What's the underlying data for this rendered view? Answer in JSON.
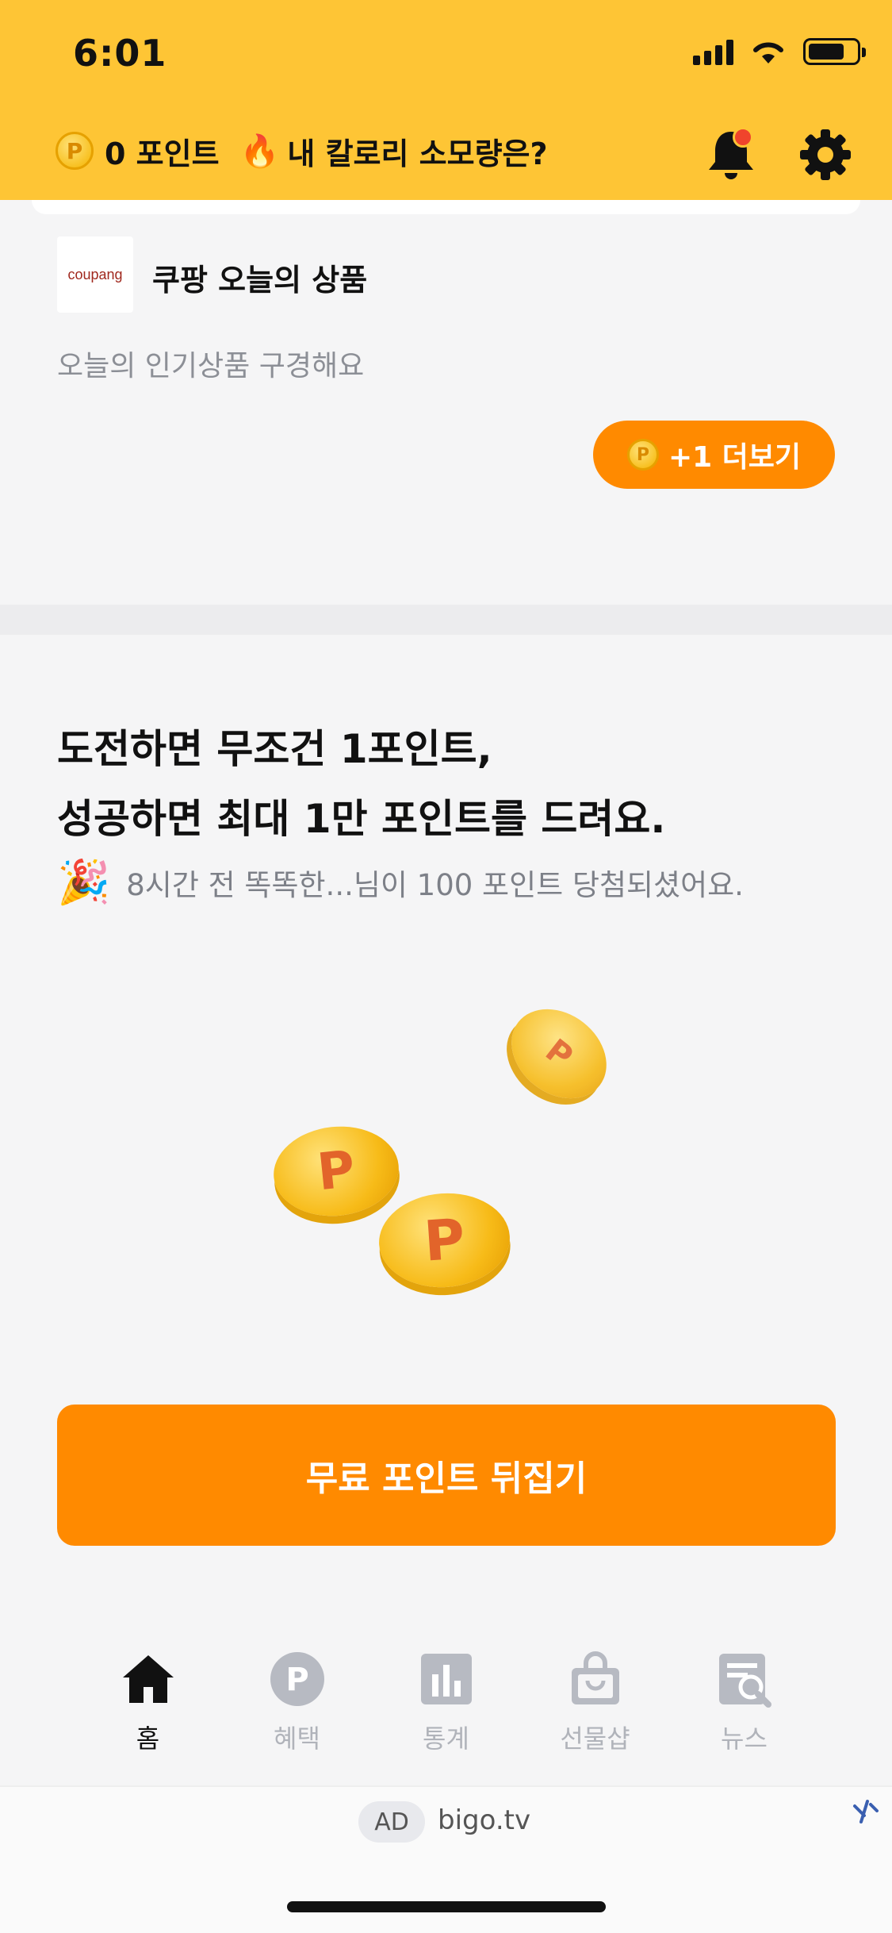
{
  "status_bar": {
    "time": "6:01"
  },
  "header": {
    "points_label": "0 포인트",
    "coin_symbol": "P",
    "calorie_label": "내 칼로리 소모량은?"
  },
  "coupang_card": {
    "logo_text": "coupang",
    "title": "쿠팡 오늘의 상품",
    "description": "오늘의 인기상품 구경해요",
    "more_button": "+1 더보기"
  },
  "challenge": {
    "title_line1": "도전하면 무조건 1포인트,",
    "title_line2": "성공하면 최대 1만 포인트를 드려요.",
    "winner_text": "8시간 전 똑똑한...님이 100 포인트 당첨되셨어요.",
    "coin_symbol": "P",
    "flip_button": "무료 포인트 뒤집기"
  },
  "tabs": [
    {
      "label": "홈",
      "icon": "home-icon",
      "active": true
    },
    {
      "label": "혜택",
      "icon": "point-icon",
      "active": false
    },
    {
      "label": "통계",
      "icon": "chart-icon",
      "active": false
    },
    {
      "label": "선물샵",
      "icon": "shopping-bag-icon",
      "active": false
    },
    {
      "label": "뉴스",
      "icon": "news-icon",
      "active": false
    }
  ],
  "ad": {
    "tag": "AD",
    "text": "bigo.tv"
  },
  "colors": {
    "header": "#fec535",
    "accent": "#ff8a00",
    "notification": "#f0442c"
  }
}
